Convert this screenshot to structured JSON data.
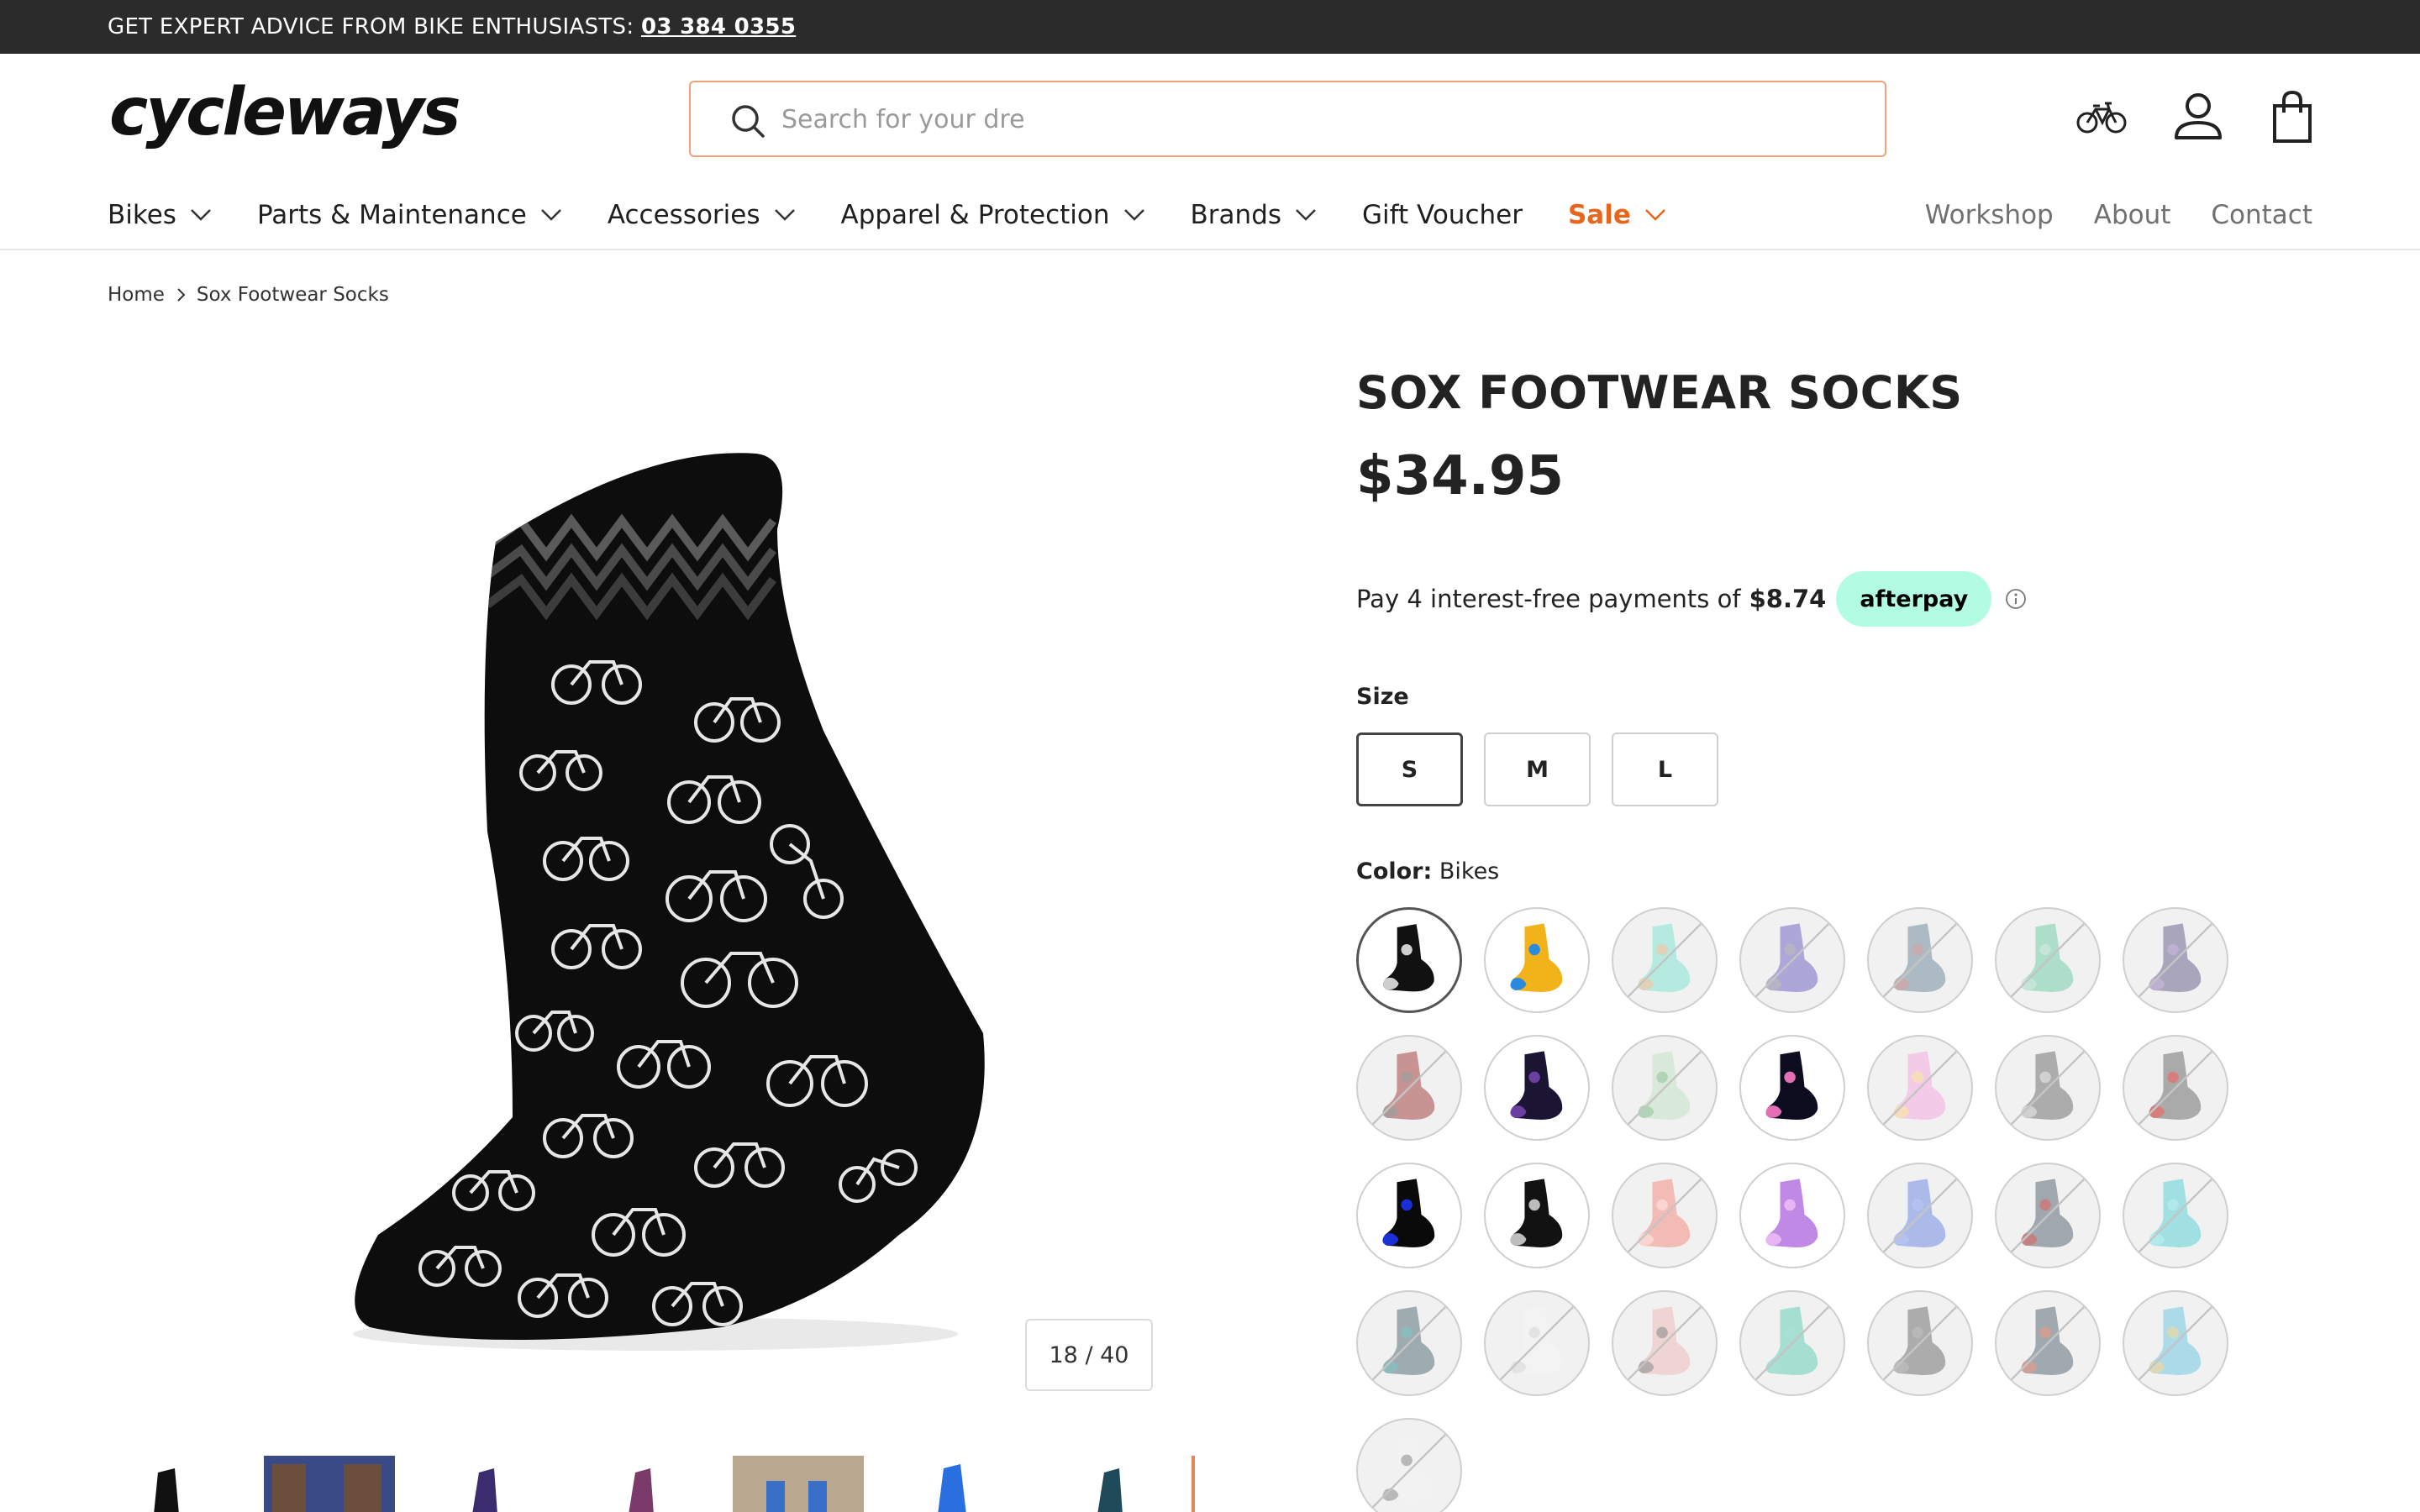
{
  "announcement": {
    "text": "GET EXPERT ADVICE FROM BIKE ENTHUSIASTS: ",
    "phone": "03 384 0355"
  },
  "header": {
    "logo_text": "cycleways",
    "search_placeholder": "Search for your dre",
    "icons": [
      "bike-icon",
      "account-icon",
      "cart-icon"
    ]
  },
  "nav": {
    "main": [
      {
        "label": "Bikes",
        "has_dropdown": true
      },
      {
        "label": "Parts & Maintenance",
        "has_dropdown": true
      },
      {
        "label": "Accessories",
        "has_dropdown": true
      },
      {
        "label": "Apparel & Protection",
        "has_dropdown": true
      },
      {
        "label": "Brands",
        "has_dropdown": true
      },
      {
        "label": "Gift Voucher",
        "has_dropdown": false
      },
      {
        "label": "Sale",
        "has_dropdown": true
      }
    ],
    "secondary": [
      "Workshop",
      "About",
      "Contact"
    ]
  },
  "breadcrumb": {
    "home": "Home",
    "current": "Sox Footwear Socks"
  },
  "product": {
    "title": "SOX FOOTWEAR SOCKS",
    "price": "$34.95",
    "afterpay_text": "Pay 4 interest-free payments of",
    "afterpay_amount": "$8.74",
    "afterpay_brand": "afterpay",
    "info_icon": "ⓘ",
    "size_label": "Size",
    "sizes": [
      "S",
      "M",
      "L"
    ],
    "selected_size": "S",
    "color_label": "Color:",
    "color_value": "Bikes",
    "gallery_counter": "18 / 40"
  },
  "colors": {
    "accent_orange": "#e8661c",
    "search_border": "#f2a27a",
    "afterpay_mint": "#b2fce4",
    "announce_bg": "#2b2b2b"
  },
  "swatches": [
    {
      "name": "Bikes",
      "available": true,
      "colors": [
        "#111111",
        "#cfcfcf"
      ],
      "selected": true
    },
    {
      "name": "multi-rainbow",
      "available": true,
      "colors": [
        "#f2b21a",
        "#2a8ae0"
      ]
    },
    {
      "name": "mint-floral",
      "available": false,
      "colors": [
        "#9be7d8",
        "#f3c6a5"
      ]
    },
    {
      "name": "galaxy-lilac",
      "available": false,
      "colors": [
        "#8f86cf",
        "#bbbbbb"
      ]
    },
    {
      "name": "grey-pattern",
      "available": false,
      "colors": [
        "#8fa3b0",
        "#d4a5a5"
      ]
    },
    {
      "name": "mint-pattern",
      "available": false,
      "colors": [
        "#8fd6b8",
        "#cfe8dd"
      ]
    },
    {
      "name": "purple-grey",
      "available": false,
      "colors": [
        "#8a84a6",
        "#c6b5d9"
      ]
    },
    {
      "name": "red-grey",
      "available": false,
      "colors": [
        "#b76b6b",
        "#9c9c9c"
      ]
    },
    {
      "name": "navy-stars",
      "available": true,
      "colors": [
        "#1c1433",
        "#6b3fa0"
      ]
    },
    {
      "name": "pale-green",
      "available": false,
      "colors": [
        "#cfe6cf",
        "#9fc9a6"
      ]
    },
    {
      "name": "space-black",
      "available": true,
      "colors": [
        "#0d0d1f",
        "#e36fb5"
      ]
    },
    {
      "name": "pastel-pink",
      "available": false,
      "colors": [
        "#f3b9e3",
        "#f7e7a4"
      ]
    },
    {
      "name": "zebra",
      "available": false,
      "colors": [
        "#8e8e8e",
        "#e0e0e0"
      ]
    },
    {
      "name": "grey-red",
      "available": false,
      "colors": [
        "#8c8c8c",
        "#e86b6b"
      ]
    },
    {
      "name": "black-blue",
      "available": true,
      "colors": [
        "#0a0a0a",
        "#1b2fd6"
      ]
    },
    {
      "name": "black-dots",
      "available": true,
      "colors": [
        "#121212",
        "#bdbdbd"
      ]
    },
    {
      "name": "coral-stripe",
      "available": false,
      "colors": [
        "#f2a49b",
        "#fbe0dc"
      ]
    },
    {
      "name": "lilac-fantasy",
      "available": true,
      "colors": [
        "#c189e6",
        "#e8b6f5"
      ]
    },
    {
      "name": "periwinkle",
      "available": false,
      "colors": [
        "#8ea2e6",
        "#b9c6f2"
      ]
    },
    {
      "name": "grey-floral",
      "available": false,
      "colors": [
        "#7e8791",
        "#d46f6f"
      ]
    },
    {
      "name": "aqua",
      "available": false,
      "colors": [
        "#7fd9dc",
        "#b9eef0"
      ]
    },
    {
      "name": "slate-teal",
      "available": false,
      "colors": [
        "#7b8e95",
        "#83c3c0"
      ]
    },
    {
      "name": "white",
      "available": false,
      "colors": [
        "#f4f4f4",
        "#dcdcdc"
      ]
    },
    {
      "name": "pink-doodle",
      "available": false,
      "colors": [
        "#f0c6c6",
        "#9a9a9a"
      ]
    },
    {
      "name": "seafoam",
      "available": false,
      "colors": [
        "#86d6c4",
        "#a8e3d6"
      ]
    },
    {
      "name": "grey-map",
      "available": false,
      "colors": [
        "#8e8e8e",
        "#bdbdbd"
      ]
    },
    {
      "name": "grey-cartoon",
      "available": false,
      "colors": [
        "#7e8a94",
        "#e39a8a"
      ]
    },
    {
      "name": "sky-pattern",
      "available": false,
      "colors": [
        "#8fd0e6",
        "#f0d7a0"
      ]
    },
    {
      "name": "white-dots",
      "available": false,
      "colors": [
        "#f2f2f2",
        "#a0a0a0"
      ]
    }
  ],
  "thumbnails": [
    {
      "colors": [
        "#ffffff",
        "#111111"
      ]
    },
    {
      "colors": [
        "#3a4a86",
        "#6b4f3c"
      ]
    },
    {
      "colors": [
        "#ffffff",
        "#3a2c6f"
      ]
    },
    {
      "colors": [
        "#ffffff",
        "#7a3b6b"
      ]
    },
    {
      "colors": [
        "#b9a88f",
        "#3a6fc7"
      ]
    },
    {
      "colors": [
        "#ffffff",
        "#2a6fe0"
      ]
    },
    {
      "colors": [
        "#ffffff",
        "#1f4a5a"
      ]
    },
    {
      "colors": [
        "#ffffff",
        "#e2865d"
      ]
    }
  ]
}
